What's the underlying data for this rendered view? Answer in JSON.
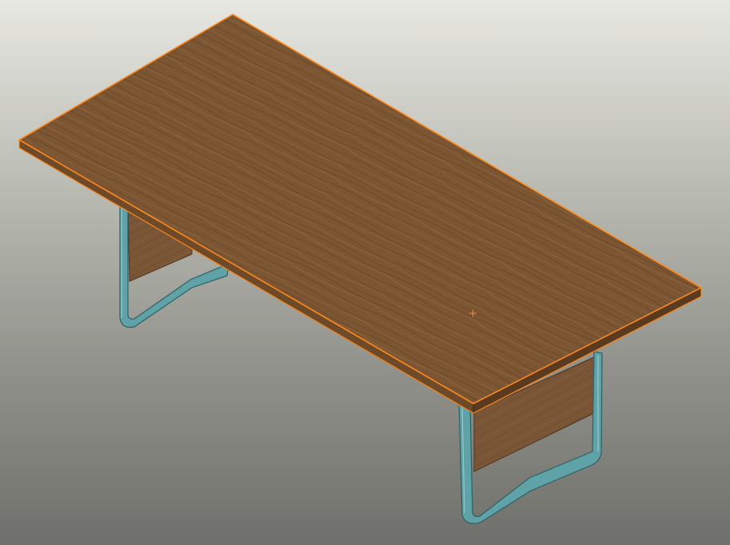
{
  "viewport": {
    "background_top": "#e8e8e2",
    "background_bottom": "#6f706b"
  },
  "model": {
    "object": "table",
    "tabletop_color": "#7c5632",
    "tabletop_edge_highlight": "#ff8a1f",
    "leg_frame_color": "#5fa3a8",
    "modesty_panel_color": "#7a5636",
    "selected": true
  },
  "cursor": {
    "icon": "crosshair-cursor-icon",
    "color": "#ff8a1f"
  }
}
